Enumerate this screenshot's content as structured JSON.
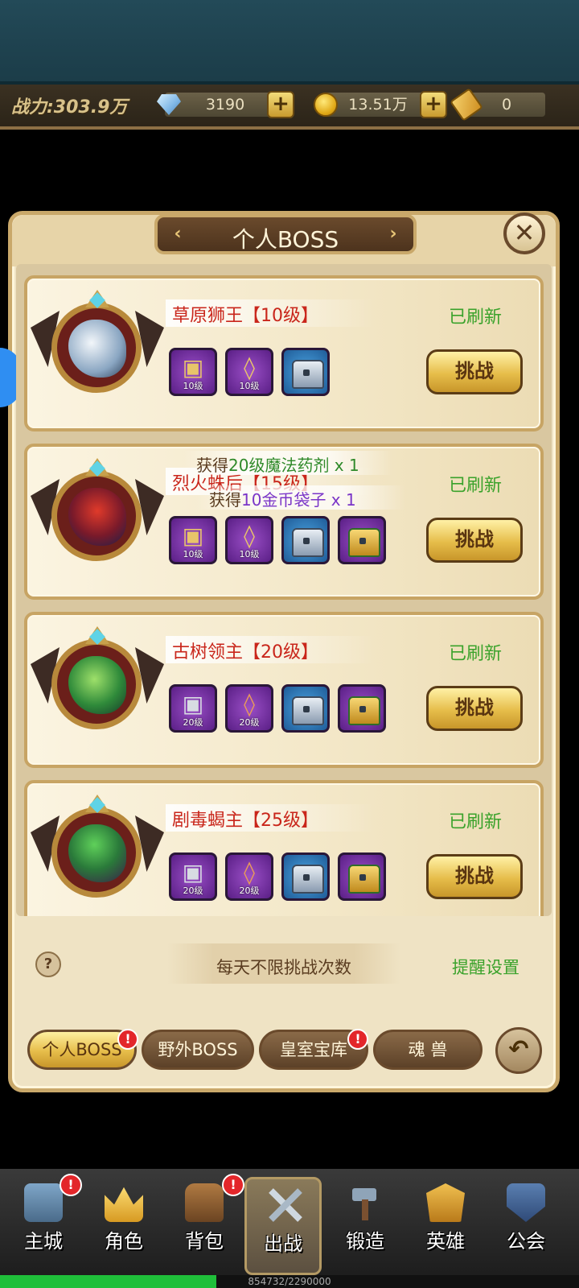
{
  "topbar": {
    "power": "战力:303.9万",
    "diamonds": "3190",
    "gold": "13.51万",
    "tickets": "0"
  },
  "panel": {
    "title": "个人BOSS",
    "close_label": "✕"
  },
  "bosses": [
    {
      "name": "草原狮王【10级】",
      "status": "已刷新",
      "button": "挑战",
      "items": [
        {
          "kind": "armor",
          "level": "10级"
        },
        {
          "kind": "amulet",
          "level": "10级"
        },
        {
          "kind": "silver-chest",
          "level": ""
        }
      ]
    },
    {
      "name": "烈火蛛后【15级】",
      "status": "已刷新",
      "button": "挑战",
      "items": [
        {
          "kind": "armor",
          "level": "10级"
        },
        {
          "kind": "amulet",
          "level": "10级"
        },
        {
          "kind": "silver-chest",
          "level": ""
        },
        {
          "kind": "gold-chest",
          "level": ""
        }
      ]
    },
    {
      "name": "古树领主【20级】",
      "status": "已刷新",
      "button": "挑战",
      "items": [
        {
          "kind": "armor",
          "level": "20级"
        },
        {
          "kind": "amulet",
          "level": "20级"
        },
        {
          "kind": "silver-chest",
          "level": ""
        },
        {
          "kind": "gold-chest",
          "level": ""
        }
      ]
    },
    {
      "name": "剧毒蝎主【25级】",
      "status": "已刷新",
      "button": "挑战",
      "items": [
        {
          "kind": "armor",
          "level": "20级"
        },
        {
          "kind": "amulet",
          "level": "20级"
        },
        {
          "kind": "silver-chest",
          "level": ""
        },
        {
          "kind": "gold-chest",
          "level": ""
        }
      ]
    }
  ],
  "toasts": {
    "line1_prefix": "获得",
    "line1_item": "20级魔法药剂 x 1",
    "line2_prefix": "获得",
    "line2_item": "10金币袋子 x 1"
  },
  "footer": {
    "help": "?",
    "limit_text": "每天不限挑战次数",
    "remind_text": "提醒设置"
  },
  "tabs": [
    {
      "label": "个人BOSS",
      "badge": "!"
    },
    {
      "label": "野外BOSS",
      "badge": ""
    },
    {
      "label": "皇室宝库",
      "badge": "!"
    },
    {
      "label": "魂 兽",
      "badge": ""
    }
  ],
  "back_label": "↶",
  "nav": [
    {
      "label": "主城",
      "badge": "!"
    },
    {
      "label": "角色",
      "badge": ""
    },
    {
      "label": "背包",
      "badge": "!"
    },
    {
      "label": "出战",
      "badge": ""
    },
    {
      "label": "锻造",
      "badge": ""
    },
    {
      "label": "英雄",
      "badge": ""
    },
    {
      "label": "公会",
      "badge": ""
    }
  ],
  "xp": {
    "text": "854732/2290000",
    "current": 854732,
    "max": 2290000
  },
  "colors": {
    "status_green": "#3aa22b",
    "boss_red": "#c9261b",
    "purple_item": "#7a35a8",
    "blue_item": "#2f76b8"
  }
}
